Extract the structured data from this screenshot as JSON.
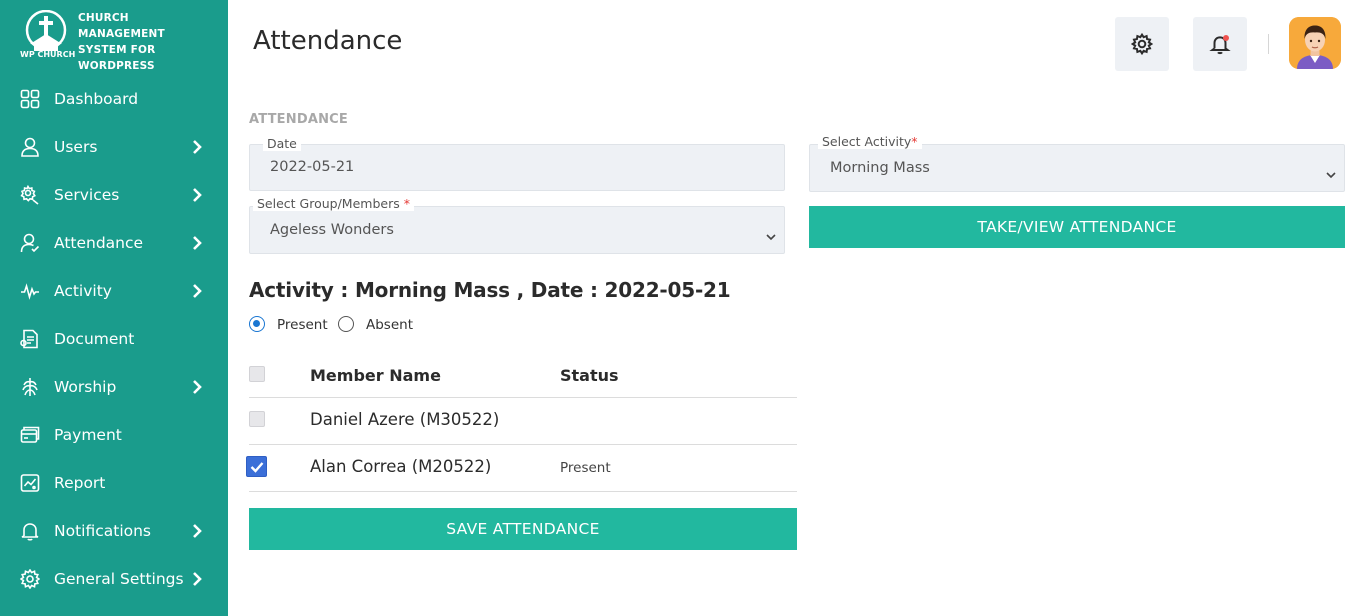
{
  "brand": {
    "title": "CHURCH MANAGEMENT\nSYSTEM FOR\nWORDPRESS",
    "logo_text": "WP CHURCH"
  },
  "sidebar": {
    "items": [
      {
        "label": "Dashboard",
        "icon": "dashboard-icon",
        "has_submenu": false
      },
      {
        "label": "Users",
        "icon": "user-icon",
        "has_submenu": true
      },
      {
        "label": "Services",
        "icon": "services-icon",
        "has_submenu": true
      },
      {
        "label": "Attendance",
        "icon": "attendance-icon",
        "has_submenu": true
      },
      {
        "label": "Activity",
        "icon": "activity-icon",
        "has_submenu": true
      },
      {
        "label": "Document",
        "icon": "document-icon",
        "has_submenu": false
      },
      {
        "label": "Worship",
        "icon": "worship-icon",
        "has_submenu": true
      },
      {
        "label": "Payment",
        "icon": "payment-icon",
        "has_submenu": false
      },
      {
        "label": "Report",
        "icon": "report-icon",
        "has_submenu": false
      },
      {
        "label": "Notifications",
        "icon": "bell-icon",
        "has_submenu": true
      },
      {
        "label": "General Settings",
        "icon": "gear-icon",
        "has_submenu": true
      }
    ]
  },
  "header": {
    "title": "Attendance"
  },
  "form": {
    "section_label": "ATTENDANCE",
    "date": {
      "label": "Date",
      "value": "2022-05-21"
    },
    "activity": {
      "label": "Select Activity",
      "required": "*",
      "value": "Morning Mass"
    },
    "group": {
      "label": "Select Group/Members ",
      "required": "*",
      "value": "Ageless Wonders"
    },
    "take_view_button": "TAKE/VIEW  ATTENDANCE"
  },
  "attendance": {
    "heading": "Activity : Morning Mass , Date : 2022-05-21",
    "filter": {
      "present_label": "Present",
      "absent_label": "Absent",
      "selected": "Present"
    },
    "columns": {
      "name": "Member Name",
      "status": "Status"
    },
    "rows": [
      {
        "name": "Daniel Azere (M30522)",
        "status": "",
        "checked": false
      },
      {
        "name": "Alan Correa (M20522)",
        "status": "Present",
        "checked": true
      }
    ],
    "save_button": "SAVE ATTENDANCE"
  },
  "colors": {
    "sidebar": "#1a9c8c",
    "accent": "#22b89f",
    "checkbox_checked": "#3b6fd8",
    "required": "#e53935"
  }
}
